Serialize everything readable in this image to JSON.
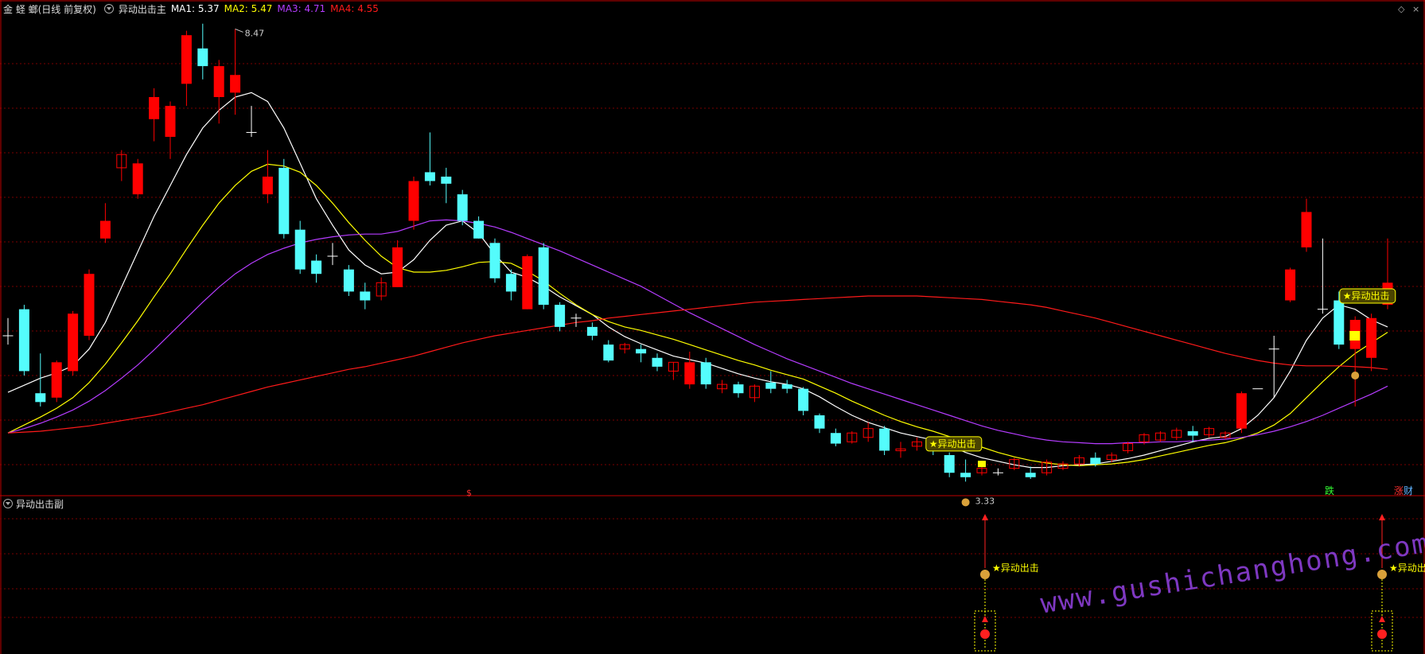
{
  "header": {
    "stock_name": "金 蛏 螂(日线 前复权)",
    "main_indicator": "异动出击主",
    "ma1": "MA1: 5.37",
    "ma2": "MA2: 5.47",
    "ma3": "MA3: 4.71",
    "ma4": "MA4: 4.55"
  },
  "sub_panel": {
    "title": "异动出击副"
  },
  "annotations": {
    "high_price": "8.47",
    "low_price": "3.33",
    "signal_label": "★异动出击",
    "signal_label_2": "★异动出击",
    "sub_signal_1": "★异动出击",
    "sub_signal_2": "★异动出击",
    "dollar_mark": "$",
    "fall_mark": "跌",
    "rise_mark": "涨",
    "wealth_mark": "财"
  },
  "watermark": "www.gushichanghong.com",
  "colors": {
    "up": "#ff0000",
    "down": "#54fcfc",
    "ma1": "#ffffff",
    "ma2": "#ffff00",
    "ma3": "#b53cff",
    "ma4": "#ff1a1a",
    "grid": "#7a0000",
    "signal": "#ffff00"
  },
  "chart_data": {
    "type": "candlestick",
    "price_range": [
      3.2,
      8.6
    ],
    "candles": [
      [
        5.0,
        5.0,
        5.2,
        4.9
      ],
      [
        5.3,
        4.6,
        5.35,
        4.55
      ],
      [
        4.35,
        4.25,
        4.8,
        4.2
      ],
      [
        4.3,
        4.7,
        4.72,
        4.25
      ],
      [
        4.6,
        5.25,
        5.28,
        4.55
      ],
      [
        5.0,
        5.7,
        5.75,
        4.95
      ],
      [
        6.1,
        6.3,
        6.5,
        6.05
      ],
      [
        6.9,
        7.05,
        7.1,
        6.75
      ],
      [
        6.6,
        6.95,
        7.0,
        6.55
      ],
      [
        7.45,
        7.7,
        7.8,
        7.2
      ],
      [
        7.25,
        7.6,
        7.65,
        7.0
      ],
      [
        7.85,
        8.4,
        8.45,
        7.6
      ],
      [
        8.25,
        8.05,
        8.53,
        7.9
      ],
      [
        7.7,
        8.05,
        8.12,
        7.4
      ],
      [
        7.75,
        7.95,
        8.47,
        7.5
      ],
      [
        7.3,
        7.3,
        7.6,
        7.25
      ],
      [
        6.6,
        6.8,
        7.1,
        6.5
      ],
      [
        6.9,
        6.15,
        7.0,
        6.1
      ],
      [
        6.2,
        5.75,
        6.3,
        5.7
      ],
      [
        5.85,
        5.7,
        5.92,
        5.6
      ],
      [
        5.9,
        5.9,
        6.05,
        5.8
      ],
      [
        5.75,
        5.5,
        5.8,
        5.45
      ],
      [
        5.5,
        5.4,
        5.6,
        5.3
      ],
      [
        5.45,
        5.6,
        5.66,
        5.4
      ],
      [
        5.55,
        6.0,
        6.08,
        5.55
      ],
      [
        6.3,
        6.75,
        6.8,
        6.2
      ],
      [
        6.85,
        6.75,
        7.3,
        6.7
      ],
      [
        6.8,
        6.72,
        6.9,
        6.5
      ],
      [
        6.6,
        6.3,
        6.65,
        6.25
      ],
      [
        6.3,
        6.1,
        6.35,
        6.1
      ],
      [
        6.05,
        5.65,
        6.1,
        5.6
      ],
      [
        5.7,
        5.5,
        5.75,
        5.4
      ],
      [
        5.3,
        5.9,
        5.92,
        5.3
      ],
      [
        6.0,
        5.35,
        6.05,
        5.3
      ],
      [
        5.35,
        5.1,
        5.38,
        5.05
      ],
      [
        5.2,
        5.2,
        5.25,
        5.1
      ],
      [
        5.1,
        5.0,
        5.15,
        4.95
      ],
      [
        4.9,
        4.72,
        4.95,
        4.7
      ],
      [
        4.85,
        4.9,
        4.92,
        4.8
      ],
      [
        4.85,
        4.8,
        4.9,
        4.7
      ],
      [
        4.75,
        4.65,
        4.8,
        4.6
      ],
      [
        4.6,
        4.7,
        4.7,
        4.5
      ],
      [
        4.45,
        4.7,
        4.82,
        4.4
      ],
      [
        4.7,
        4.45,
        4.75,
        4.4
      ],
      [
        4.4,
        4.45,
        4.5,
        4.35
      ],
      [
        4.45,
        4.35,
        4.48,
        4.3
      ],
      [
        4.3,
        4.43,
        4.45,
        4.25
      ],
      [
        4.47,
        4.4,
        4.6,
        4.35
      ],
      [
        4.45,
        4.4,
        4.5,
        4.35
      ],
      [
        4.4,
        4.15,
        4.42,
        4.1
      ],
      [
        4.1,
        3.95,
        4.12,
        3.9
      ],
      [
        3.9,
        3.78,
        3.95,
        3.75
      ],
      [
        3.8,
        3.9,
        3.92,
        3.78
      ],
      [
        3.85,
        3.95,
        4.02,
        3.8
      ],
      [
        3.95,
        3.7,
        3.98,
        3.65
      ],
      [
        3.7,
        3.72,
        3.8,
        3.62
      ],
      [
        3.75,
        3.8,
        3.85,
        3.7
      ],
      [
        3.75,
        3.7,
        3.8,
        3.65
      ],
      [
        3.65,
        3.45,
        3.68,
        3.4
      ],
      [
        3.45,
        3.4,
        3.6,
        3.35
      ],
      [
        3.45,
        3.5,
        3.52,
        3.42
      ],
      [
        3.45,
        3.45,
        3.5,
        3.42
      ],
      [
        3.5,
        3.6,
        3.62,
        3.48
      ],
      [
        3.45,
        3.4,
        3.52,
        3.38
      ],
      [
        3.45,
        3.57,
        3.6,
        3.42
      ],
      [
        3.5,
        3.55,
        3.58,
        3.48
      ],
      [
        3.55,
        3.62,
        3.65,
        3.52
      ],
      [
        3.62,
        3.55,
        3.68,
        3.52
      ],
      [
        3.6,
        3.65,
        3.68,
        3.57
      ],
      [
        3.7,
        3.78,
        3.8,
        3.67
      ],
      [
        3.8,
        3.88,
        3.9,
        3.77
      ],
      [
        3.82,
        3.9,
        3.92,
        3.8
      ],
      [
        3.85,
        3.93,
        3.96,
        3.82
      ],
      [
        3.92,
        3.87,
        3.98,
        3.8
      ],
      [
        3.88,
        3.95,
        3.97,
        3.85
      ],
      [
        3.85,
        3.9,
        3.92,
        3.83
      ],
      [
        3.95,
        4.35,
        4.37,
        3.9
      ],
      [
        4.4,
        4.4,
        4.4,
        4.4
      ],
      [
        4.85,
        4.85,
        5.0,
        4.3
      ],
      [
        5.4,
        5.75,
        5.77,
        5.38
      ],
      [
        6.0,
        6.4,
        6.55,
        5.95
      ],
      [
        5.3,
        5.3,
        6.1,
        5.25
      ],
      [
        5.4,
        4.9,
        5.5,
        4.85
      ],
      [
        4.85,
        5.18,
        5.22,
        4.2
      ],
      [
        4.75,
        5.2,
        5.25,
        4.6
      ],
      [
        5.35,
        5.6,
        6.1,
        5.3
      ]
    ],
    "ma1": [
      4.36,
      4.44,
      4.52,
      4.58,
      4.66,
      4.85,
      5.15,
      5.55,
      5.95,
      6.35,
      6.7,
      7.05,
      7.35,
      7.55,
      7.7,
      7.75,
      7.65,
      7.35,
      6.95,
      6.55,
      6.25,
      5.97,
      5.8,
      5.7,
      5.72,
      5.86,
      6.08,
      6.25,
      6.3,
      6.16,
      5.92,
      5.72,
      5.66,
      5.56,
      5.44,
      5.34,
      5.24,
      5.1,
      4.99,
      4.91,
      4.84,
      4.77,
      4.73,
      4.69,
      4.63,
      4.57,
      4.52,
      4.48,
      4.45,
      4.4,
      4.31,
      4.2,
      4.1,
      4.02,
      3.96,
      3.9,
      3.86,
      3.82,
      3.76,
      3.68,
      3.62,
      3.58,
      3.54,
      3.51,
      3.51,
      3.53,
      3.54,
      3.55,
      3.58,
      3.61,
      3.65,
      3.7,
      3.75,
      3.8,
      3.84,
      3.86,
      3.95,
      4.1,
      4.3,
      4.6,
      4.95,
      5.2,
      5.35,
      5.3,
      5.18,
      5.1
    ],
    "ma2": [
      3.9,
      3.99,
      4.08,
      4.18,
      4.3,
      4.47,
      4.68,
      4.92,
      5.17,
      5.44,
      5.7,
      5.98,
      6.25,
      6.5,
      6.7,
      6.86,
      6.94,
      6.92,
      6.85,
      6.7,
      6.5,
      6.28,
      6.08,
      5.9,
      5.77,
      5.72,
      5.72,
      5.74,
      5.78,
      5.83,
      5.84,
      5.82,
      5.73,
      5.62,
      5.48,
      5.35,
      5.24,
      5.16,
      5.1,
      5.06,
      5.01,
      4.96,
      4.9,
      4.84,
      4.78,
      4.72,
      4.67,
      4.61,
      4.56,
      4.51,
      4.43,
      4.35,
      4.26,
      4.18,
      4.1,
      4.03,
      3.97,
      3.92,
      3.86,
      3.8,
      3.74,
      3.68,
      3.63,
      3.59,
      3.56,
      3.54,
      3.53,
      3.54,
      3.55,
      3.57,
      3.6,
      3.64,
      3.68,
      3.72,
      3.76,
      3.79,
      3.84,
      3.9,
      3.99,
      4.12,
      4.3,
      4.48,
      4.65,
      4.8,
      4.92,
      5.04
    ],
    "ma3": [
      3.9,
      3.95,
      4.01,
      4.08,
      4.16,
      4.26,
      4.38,
      4.52,
      4.67,
      4.84,
      5.02,
      5.2,
      5.38,
      5.55,
      5.7,
      5.82,
      5.92,
      5.99,
      6.05,
      6.09,
      6.12,
      6.14,
      6.15,
      6.15,
      6.18,
      6.24,
      6.3,
      6.31,
      6.3,
      6.27,
      6.23,
      6.17,
      6.1,
      6.03,
      5.96,
      5.88,
      5.8,
      5.72,
      5.64,
      5.56,
      5.46,
      5.36,
      5.26,
      5.17,
      5.08,
      4.99,
      4.9,
      4.82,
      4.74,
      4.67,
      4.6,
      4.53,
      4.46,
      4.4,
      4.34,
      4.28,
      4.22,
      4.16,
      4.1,
      4.04,
      3.98,
      3.93,
      3.89,
      3.85,
      3.82,
      3.8,
      3.79,
      3.78,
      3.78,
      3.79,
      3.79,
      3.8,
      3.8,
      3.81,
      3.82,
      3.83,
      3.85,
      3.88,
      3.92,
      3.97,
      4.03,
      4.1,
      4.18,
      4.26,
      4.34,
      4.43
    ],
    "ma4": [
      3.9,
      3.91,
      3.92,
      3.94,
      3.96,
      3.98,
      4.01,
      4.04,
      4.07,
      4.1,
      4.14,
      4.18,
      4.22,
      4.27,
      4.32,
      4.37,
      4.42,
      4.46,
      4.5,
      4.54,
      4.58,
      4.62,
      4.65,
      4.69,
      4.73,
      4.77,
      4.82,
      4.87,
      4.92,
      4.96,
      5.0,
      5.03,
      5.06,
      5.09,
      5.12,
      5.15,
      5.17,
      5.2,
      5.22,
      5.24,
      5.26,
      5.28,
      5.3,
      5.32,
      5.34,
      5.36,
      5.38,
      5.39,
      5.4,
      5.41,
      5.42,
      5.43,
      5.44,
      5.45,
      5.45,
      5.45,
      5.45,
      5.44,
      5.43,
      5.42,
      5.41,
      5.39,
      5.37,
      5.35,
      5.32,
      5.28,
      5.24,
      5.2,
      5.15,
      5.1,
      5.05,
      5.0,
      4.95,
      4.9,
      4.85,
      4.8,
      4.76,
      4.72,
      4.69,
      4.67,
      4.66,
      4.66,
      4.66,
      4.65,
      4.64,
      4.62
    ]
  }
}
